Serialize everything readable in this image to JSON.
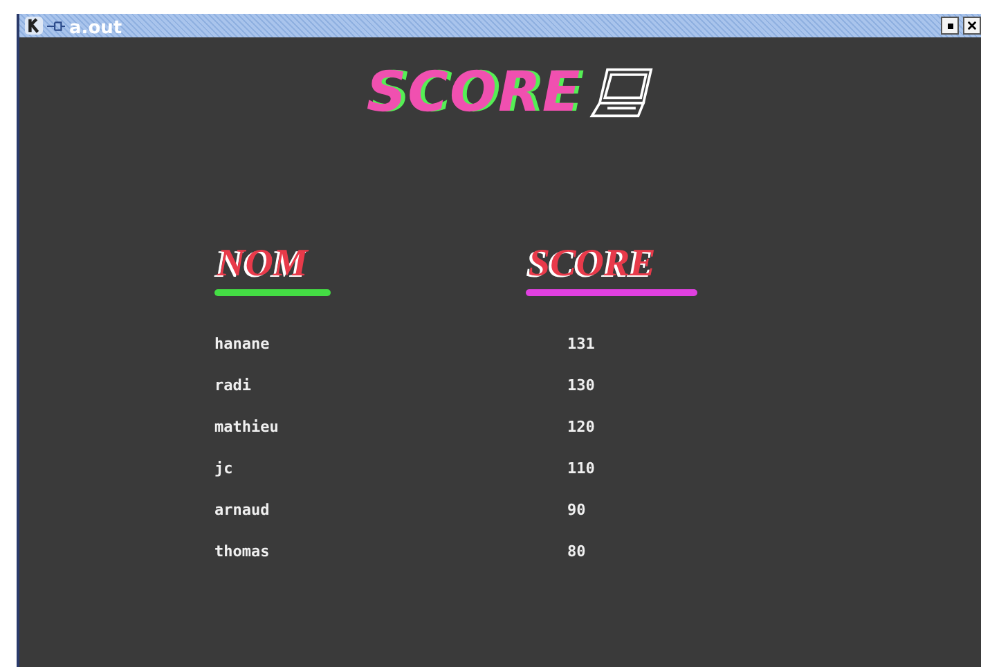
{
  "window": {
    "title": "a.out"
  },
  "title": "SCORE",
  "columns": [
    {
      "label": "NOM",
      "color": "#44dd44"
    },
    {
      "label": "SCORE",
      "color": "#e040e0"
    }
  ],
  "rows": [
    {
      "name": "hanane",
      "score": "131"
    },
    {
      "name": "radi",
      "score": "130"
    },
    {
      "name": "mathieu",
      "score": "120"
    },
    {
      "name": "jc",
      "score": "110"
    },
    {
      "name": "arnaud",
      "score": "90"
    },
    {
      "name": "thomas",
      "score": "80"
    }
  ]
}
